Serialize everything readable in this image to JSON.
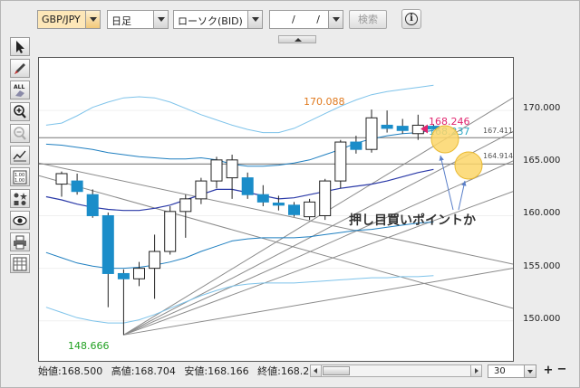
{
  "toolbar": {
    "symbol": "GBP/JPY",
    "period": "日足",
    "chart_type": "ローソク(BID)",
    "date_field": "/ /",
    "search_label": "検索",
    "info_icon": "info-icon"
  },
  "tools": [
    "cursor-icon",
    "pen-icon",
    "eraser-all-icon",
    "zoom-in-icon",
    "zoom-out-icon",
    "indicator-icon",
    "price-table-icon",
    "symbol-icon",
    "eye-icon",
    "print-icon",
    "grid-icon"
  ],
  "price_axis": {
    "ticks": [
      "170.000",
      "165.000",
      "160.000",
      "155.000",
      "150.000"
    ]
  },
  "annotations": {
    "high_label": "170.088",
    "low_label": "148.666",
    "price_red": "168.246",
    "price_blue": "168.237",
    "line_label_1": "167.411",
    "line_label_2": "164.914",
    "pullback_text": "押し目買いポイントか"
  },
  "status": {
    "open": "始値:168.500",
    "high": "高値:168.704",
    "low": "安値:168.166",
    "close": "終値:168.237"
  },
  "bar_count": "30",
  "chart_data": {
    "type": "candlestick",
    "ylim": [
      146.2,
      175.0
    ],
    "yticks": [
      170,
      165,
      160,
      155,
      150
    ],
    "candles": [
      {
        "o": 163.0,
        "h": 164.2,
        "l": 161.8,
        "c": 164.0
      },
      {
        "o": 163.3,
        "h": 164.0,
        "l": 162.0,
        "c": 162.3
      },
      {
        "o": 162.0,
        "h": 162.5,
        "l": 159.8,
        "c": 160.0
      },
      {
        "o": 160.0,
        "h": 160.3,
        "l": 151.3,
        "c": 154.5
      },
      {
        "o": 154.5,
        "h": 154.9,
        "l": 148.666,
        "c": 154.0
      },
      {
        "o": 154.0,
        "h": 155.6,
        "l": 153.3,
        "c": 155.0
      },
      {
        "o": 155.0,
        "h": 158.2,
        "l": 152.1,
        "c": 156.6
      },
      {
        "o": 156.6,
        "h": 160.9,
        "l": 156.3,
        "c": 160.4
      },
      {
        "o": 160.4,
        "h": 162.0,
        "l": 157.9,
        "c": 161.6
      },
      {
        "o": 161.6,
        "h": 163.6,
        "l": 161.1,
        "c": 163.3
      },
      {
        "o": 163.3,
        "h": 165.6,
        "l": 162.6,
        "c": 165.3
      },
      {
        "o": 163.6,
        "h": 165.8,
        "l": 161.6,
        "c": 165.3
      },
      {
        "o": 163.6,
        "h": 164.1,
        "l": 161.6,
        "c": 162.0
      },
      {
        "o": 162.0,
        "h": 162.9,
        "l": 160.9,
        "c": 161.3
      },
      {
        "o": 161.2,
        "h": 161.9,
        "l": 160.5,
        "c": 161.0
      },
      {
        "o": 161.0,
        "h": 161.3,
        "l": 159.9,
        "c": 160.1
      },
      {
        "o": 159.9,
        "h": 161.6,
        "l": 159.6,
        "c": 161.3
      },
      {
        "o": 160.0,
        "h": 163.5,
        "l": 159.6,
        "c": 163.3
      },
      {
        "o": 163.3,
        "h": 167.2,
        "l": 162.6,
        "c": 167.0
      },
      {
        "o": 167.0,
        "h": 167.6,
        "l": 165.9,
        "c": 166.3
      },
      {
        "o": 166.3,
        "h": 170.088,
        "l": 166.0,
        "c": 169.3
      },
      {
        "o": 168.6,
        "h": 170.0,
        "l": 167.9,
        "c": 168.3
      },
      {
        "o": 168.5,
        "h": 169.2,
        "l": 167.8,
        "c": 168.1
      },
      {
        "o": 167.8,
        "h": 169.6,
        "l": 167.2,
        "c": 168.6
      },
      {
        "o": 168.5,
        "h": 168.704,
        "l": 168.166,
        "c": 168.237
      }
    ],
    "ma_center": [
      161.8,
      161.5,
      161.1,
      160.8,
      160.6,
      160.5,
      160.5,
      160.7,
      161.0,
      161.5,
      162.0,
      162.5,
      162.5,
      162.2,
      161.9,
      161.6,
      161.7,
      162.0,
      162.3,
      162.6,
      162.8,
      163.0,
      163.3,
      163.7,
      164.1,
      164.4
    ],
    "bb_upper1": [
      166.8,
      166.7,
      166.5,
      166.3,
      166.0,
      165.8,
      165.6,
      165.5,
      165.4,
      165.4,
      165.5,
      165.3,
      164.9,
      164.7,
      164.7,
      164.8,
      165.0,
      165.3,
      165.8,
      166.3,
      166.9,
      167.3,
      167.6,
      167.8,
      167.9,
      168.1
    ],
    "bb_upper2": [
      168.6,
      168.8,
      169.5,
      170.3,
      170.8,
      171.2,
      171.3,
      171.2,
      170.8,
      170.2,
      169.6,
      169.1,
      168.6,
      168.2,
      167.9,
      167.9,
      168.3,
      169.0,
      169.7,
      170.4,
      171.0,
      171.5,
      171.8,
      172.0,
      172.2,
      172.4
    ],
    "bb_lower1": [
      156.5,
      156.0,
      155.5,
      155.2,
      155.0,
      155.0,
      155.1,
      155.3,
      155.6,
      156.0,
      156.6,
      157.1,
      157.6,
      157.8,
      157.9,
      157.9,
      157.9,
      158.0,
      158.2,
      158.4,
      158.6,
      158.7,
      158.9,
      159.1,
      159.3,
      159.4
    ],
    "bb_lower2": [
      151.3,
      150.8,
      150.3,
      150.0,
      149.8,
      149.8,
      150.1,
      150.6,
      151.2,
      151.8,
      152.4,
      152.9,
      153.3,
      153.5,
      153.6,
      153.6,
      153.6,
      153.7,
      153.8,
      153.9,
      154.0,
      154.1,
      154.1,
      154.2,
      154.2,
      154.3
    ],
    "horizontal_lines": [
      167.411,
      164.914
    ],
    "current_price": 168.246
  }
}
